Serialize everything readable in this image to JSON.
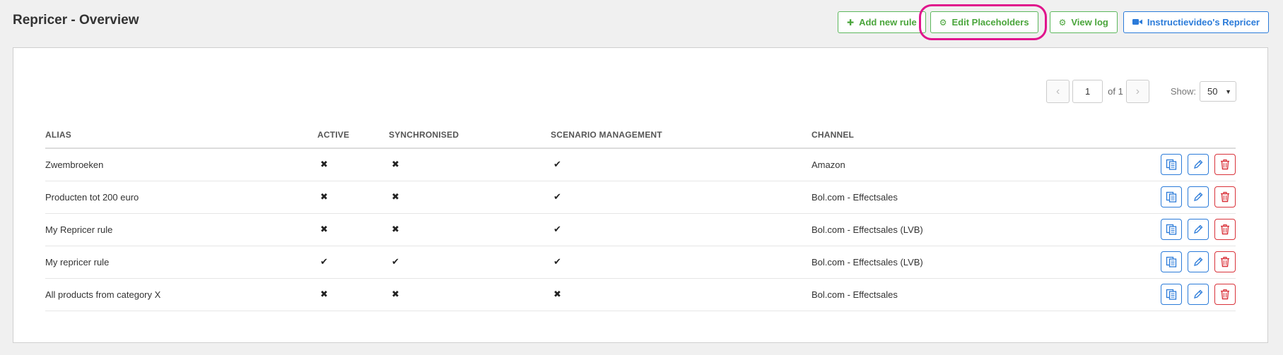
{
  "header": {
    "title": "Repricer - Overview",
    "buttons": {
      "add_rule": "Add new rule",
      "edit_placeholders": "Edit Placeholders",
      "view_log": "View log",
      "instruction_video": "Instructievideo's Repricer"
    }
  },
  "pagination": {
    "page": "1",
    "of_label": "of 1",
    "show_label": "Show:",
    "show_value": "50"
  },
  "table": {
    "columns": [
      "ALIAS",
      "ACTIVE",
      "SYNCHRONISED",
      "SCENARIO MANAGEMENT",
      "CHANNEL"
    ],
    "rows": [
      {
        "alias": "Zwembroeken",
        "active": "✖",
        "synchronised": "✖",
        "scenario": "✔",
        "channel": "Amazon"
      },
      {
        "alias": "Producten tot 200 euro",
        "active": "✖",
        "synchronised": "✖",
        "scenario": "✔",
        "channel": "Bol.com - Effectsales"
      },
      {
        "alias": "My Repricer rule",
        "active": "✖",
        "synchronised": "✖",
        "scenario": "✔",
        "channel": "Bol.com - Effectsales (LVB)"
      },
      {
        "alias": "My repricer rule",
        "active": "✔",
        "synchronised": "✔",
        "scenario": "✔",
        "channel": "Bol.com - Effectsales (LVB)"
      },
      {
        "alias": "All products from category X",
        "active": "✖",
        "synchronised": "✖",
        "scenario": "✖",
        "channel": "Bol.com - Effectsales"
      }
    ]
  },
  "colors": {
    "green": "#4aa53b",
    "blue": "#2b7bd9",
    "red": "#d9323a",
    "highlight": "#e0148c"
  },
  "icons": {
    "add": "plus-icon",
    "edit_placeholders": "gear-icon",
    "view_log": "gear-icon",
    "video": "video-camera-icon",
    "row_actions": [
      "copy-icon",
      "pencil-icon",
      "trash-icon"
    ]
  }
}
